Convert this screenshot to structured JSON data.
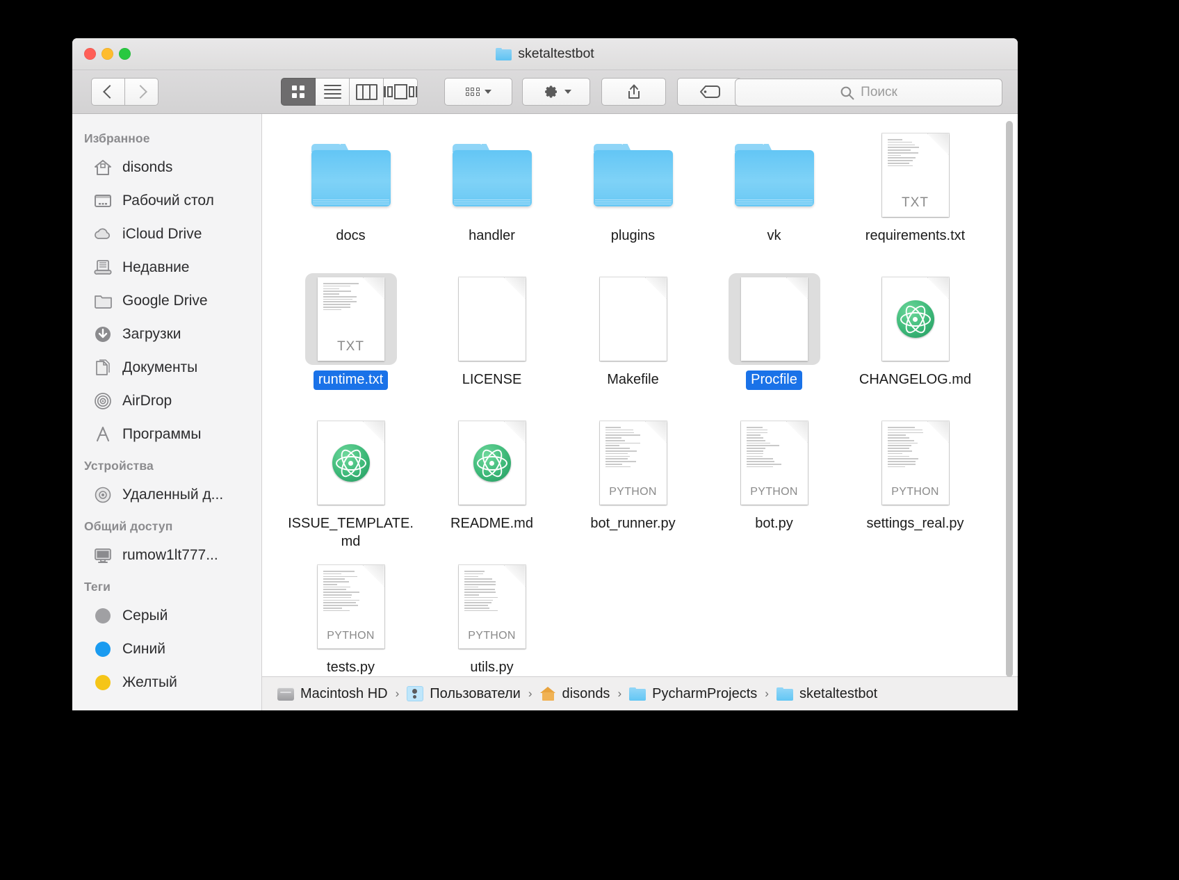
{
  "window": {
    "title": "sketaltestbot",
    "title_icon": "folder-icon",
    "traffic_lights": {
      "close": "close-window-button",
      "minimize": "minimize-window-button",
      "maximize": "maximize-window-button"
    }
  },
  "toolbar": {
    "back_icon": "chevron-left-icon",
    "forward_icon": "chevron-right-icon",
    "view_modes": [
      {
        "name": "icon-view",
        "icon": "grid-icon",
        "active": true
      },
      {
        "name": "list-view",
        "icon": "list-icon",
        "active": false
      },
      {
        "name": "column-view",
        "icon": "columns-icon",
        "active": false
      },
      {
        "name": "gallery-view",
        "icon": "coverflow-icon",
        "active": false
      }
    ],
    "arrange_icon": "arrange-dots-icon",
    "action_icon": "gear-icon",
    "share_icon": "share-icon",
    "tags_icon": "tag-icon",
    "dropdown_icon": "chevron-down-icon"
  },
  "search": {
    "placeholder": "Поиск",
    "value": "",
    "icon": "search-icon"
  },
  "sidebar": {
    "sections": [
      {
        "header": "Избранное",
        "items": [
          {
            "label": "disonds",
            "icon": "home-icon"
          },
          {
            "label": "Рабочий стол",
            "icon": "desktop-icon"
          },
          {
            "label": "iCloud Drive",
            "icon": "cloud-icon"
          },
          {
            "label": "Недавние",
            "icon": "recents-icon"
          },
          {
            "label": "Google Drive",
            "icon": "folder-icon"
          },
          {
            "label": "Загрузки",
            "icon": "downloads-icon"
          },
          {
            "label": "Документы",
            "icon": "documents-icon"
          },
          {
            "label": "AirDrop",
            "icon": "airdrop-icon"
          },
          {
            "label": "Программы",
            "icon": "applications-icon"
          }
        ]
      },
      {
        "header": "Устройства",
        "items": [
          {
            "label": "Удаленный д...",
            "icon": "disc-icon"
          }
        ]
      },
      {
        "header": "Общий доступ",
        "items": [
          {
            "label": "rumow1lt777...",
            "icon": "display-icon"
          }
        ]
      },
      {
        "header": "Теги",
        "items": [
          {
            "label": "Серый",
            "icon": "tag-dot-icon",
            "color": "#a0a0a3"
          },
          {
            "label": "Синий",
            "icon": "tag-dot-icon",
            "color": "#1a9bf0"
          },
          {
            "label": "Желтый",
            "icon": "tag-dot-icon",
            "color": "#f5c518"
          }
        ]
      }
    ]
  },
  "files": [
    {
      "name": "docs",
      "kind": "folder",
      "selected": false
    },
    {
      "name": "handler",
      "kind": "folder",
      "selected": false
    },
    {
      "name": "plugins",
      "kind": "folder",
      "selected": false
    },
    {
      "name": "vk",
      "kind": "folder",
      "selected": false
    },
    {
      "name": "requirements.txt",
      "kind": "txt",
      "badge": "TXT",
      "selected": false
    },
    {
      "name": "runtime.txt",
      "kind": "txt",
      "badge": "TXT",
      "selected": true
    },
    {
      "name": "LICENSE",
      "kind": "blank",
      "badge": "",
      "selected": false
    },
    {
      "name": "Makefile",
      "kind": "blank",
      "badge": "",
      "selected": false
    },
    {
      "name": "Procfile",
      "kind": "blank",
      "badge": "",
      "selected": true
    },
    {
      "name": "CHANGELOG.md",
      "kind": "atom",
      "badge": "",
      "selected": false
    },
    {
      "name": "ISSUE_TEMPLATE.md",
      "kind": "atom",
      "badge": "",
      "selected": false
    },
    {
      "name": "README.md",
      "kind": "atom",
      "badge": "",
      "selected": false
    },
    {
      "name": "bot_runner.py",
      "kind": "python",
      "badge": "PYTHON",
      "selected": false
    },
    {
      "name": "bot.py",
      "kind": "python",
      "badge": "PYTHON",
      "selected": false
    },
    {
      "name": "settings_real.py",
      "kind": "python",
      "badge": "PYTHON",
      "selected": false
    },
    {
      "name": "tests.py",
      "kind": "python",
      "badge": "PYTHON",
      "selected": false
    },
    {
      "name": "utils.py",
      "kind": "python",
      "badge": "PYTHON",
      "selected": false
    }
  ],
  "pathbar": {
    "crumbs": [
      {
        "label": "Macintosh HD",
        "icon": "harddisk-icon"
      },
      {
        "label": "Пользователи",
        "icon": "users-icon"
      },
      {
        "label": "disonds",
        "icon": "home-icon"
      },
      {
        "label": "PycharmProjects",
        "icon": "folder-icon"
      },
      {
        "label": "sketaltestbot",
        "icon": "folder-icon"
      }
    ],
    "separator": "›"
  },
  "colors": {
    "selection_blue": "#1a72e8",
    "folder_blue": "#7fd2f7",
    "accent_green": "#3cb878"
  }
}
